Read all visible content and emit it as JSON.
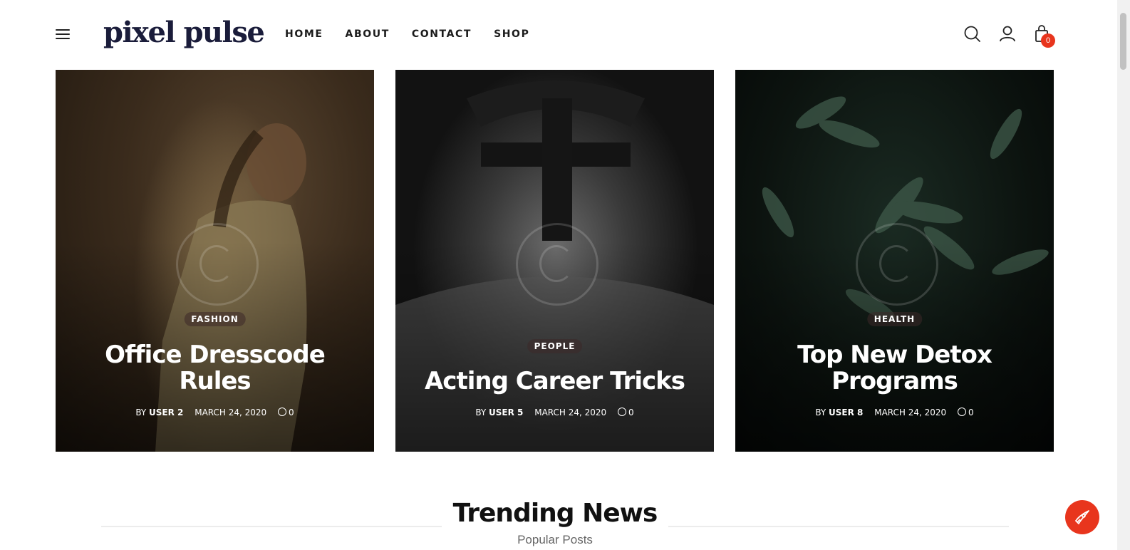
{
  "header": {
    "logo": "pixel pulse",
    "nav": [
      "HOME",
      "ABOUT",
      "CONTACT",
      "SHOP"
    ],
    "cart_count": "0"
  },
  "cards": [
    {
      "category": "FASHION",
      "title": "Office Dresscode Rules",
      "author_prefix": "BY",
      "author": "USER 2",
      "date": "MARCH 24, 2020",
      "comments": "0"
    },
    {
      "category": "PEOPLE",
      "title": "Acting Career Tricks",
      "author_prefix": "BY",
      "author": "USER 5",
      "date": "MARCH 24, 2020",
      "comments": "0"
    },
    {
      "category": "HEALTH",
      "title": "Top New Detox Programs",
      "author_prefix": "BY",
      "author": "USER 8",
      "date": "MARCH 24, 2020",
      "comments": "0"
    }
  ],
  "trending": {
    "title": "Trending News",
    "subtitle": "Popular Posts"
  },
  "colors": {
    "accent": "#e8351d",
    "logo": "#1a1c3a"
  },
  "icons": [
    "menu-icon",
    "search-icon",
    "user-icon",
    "shopping-bag-icon",
    "comment-icon",
    "rocket-icon"
  ]
}
